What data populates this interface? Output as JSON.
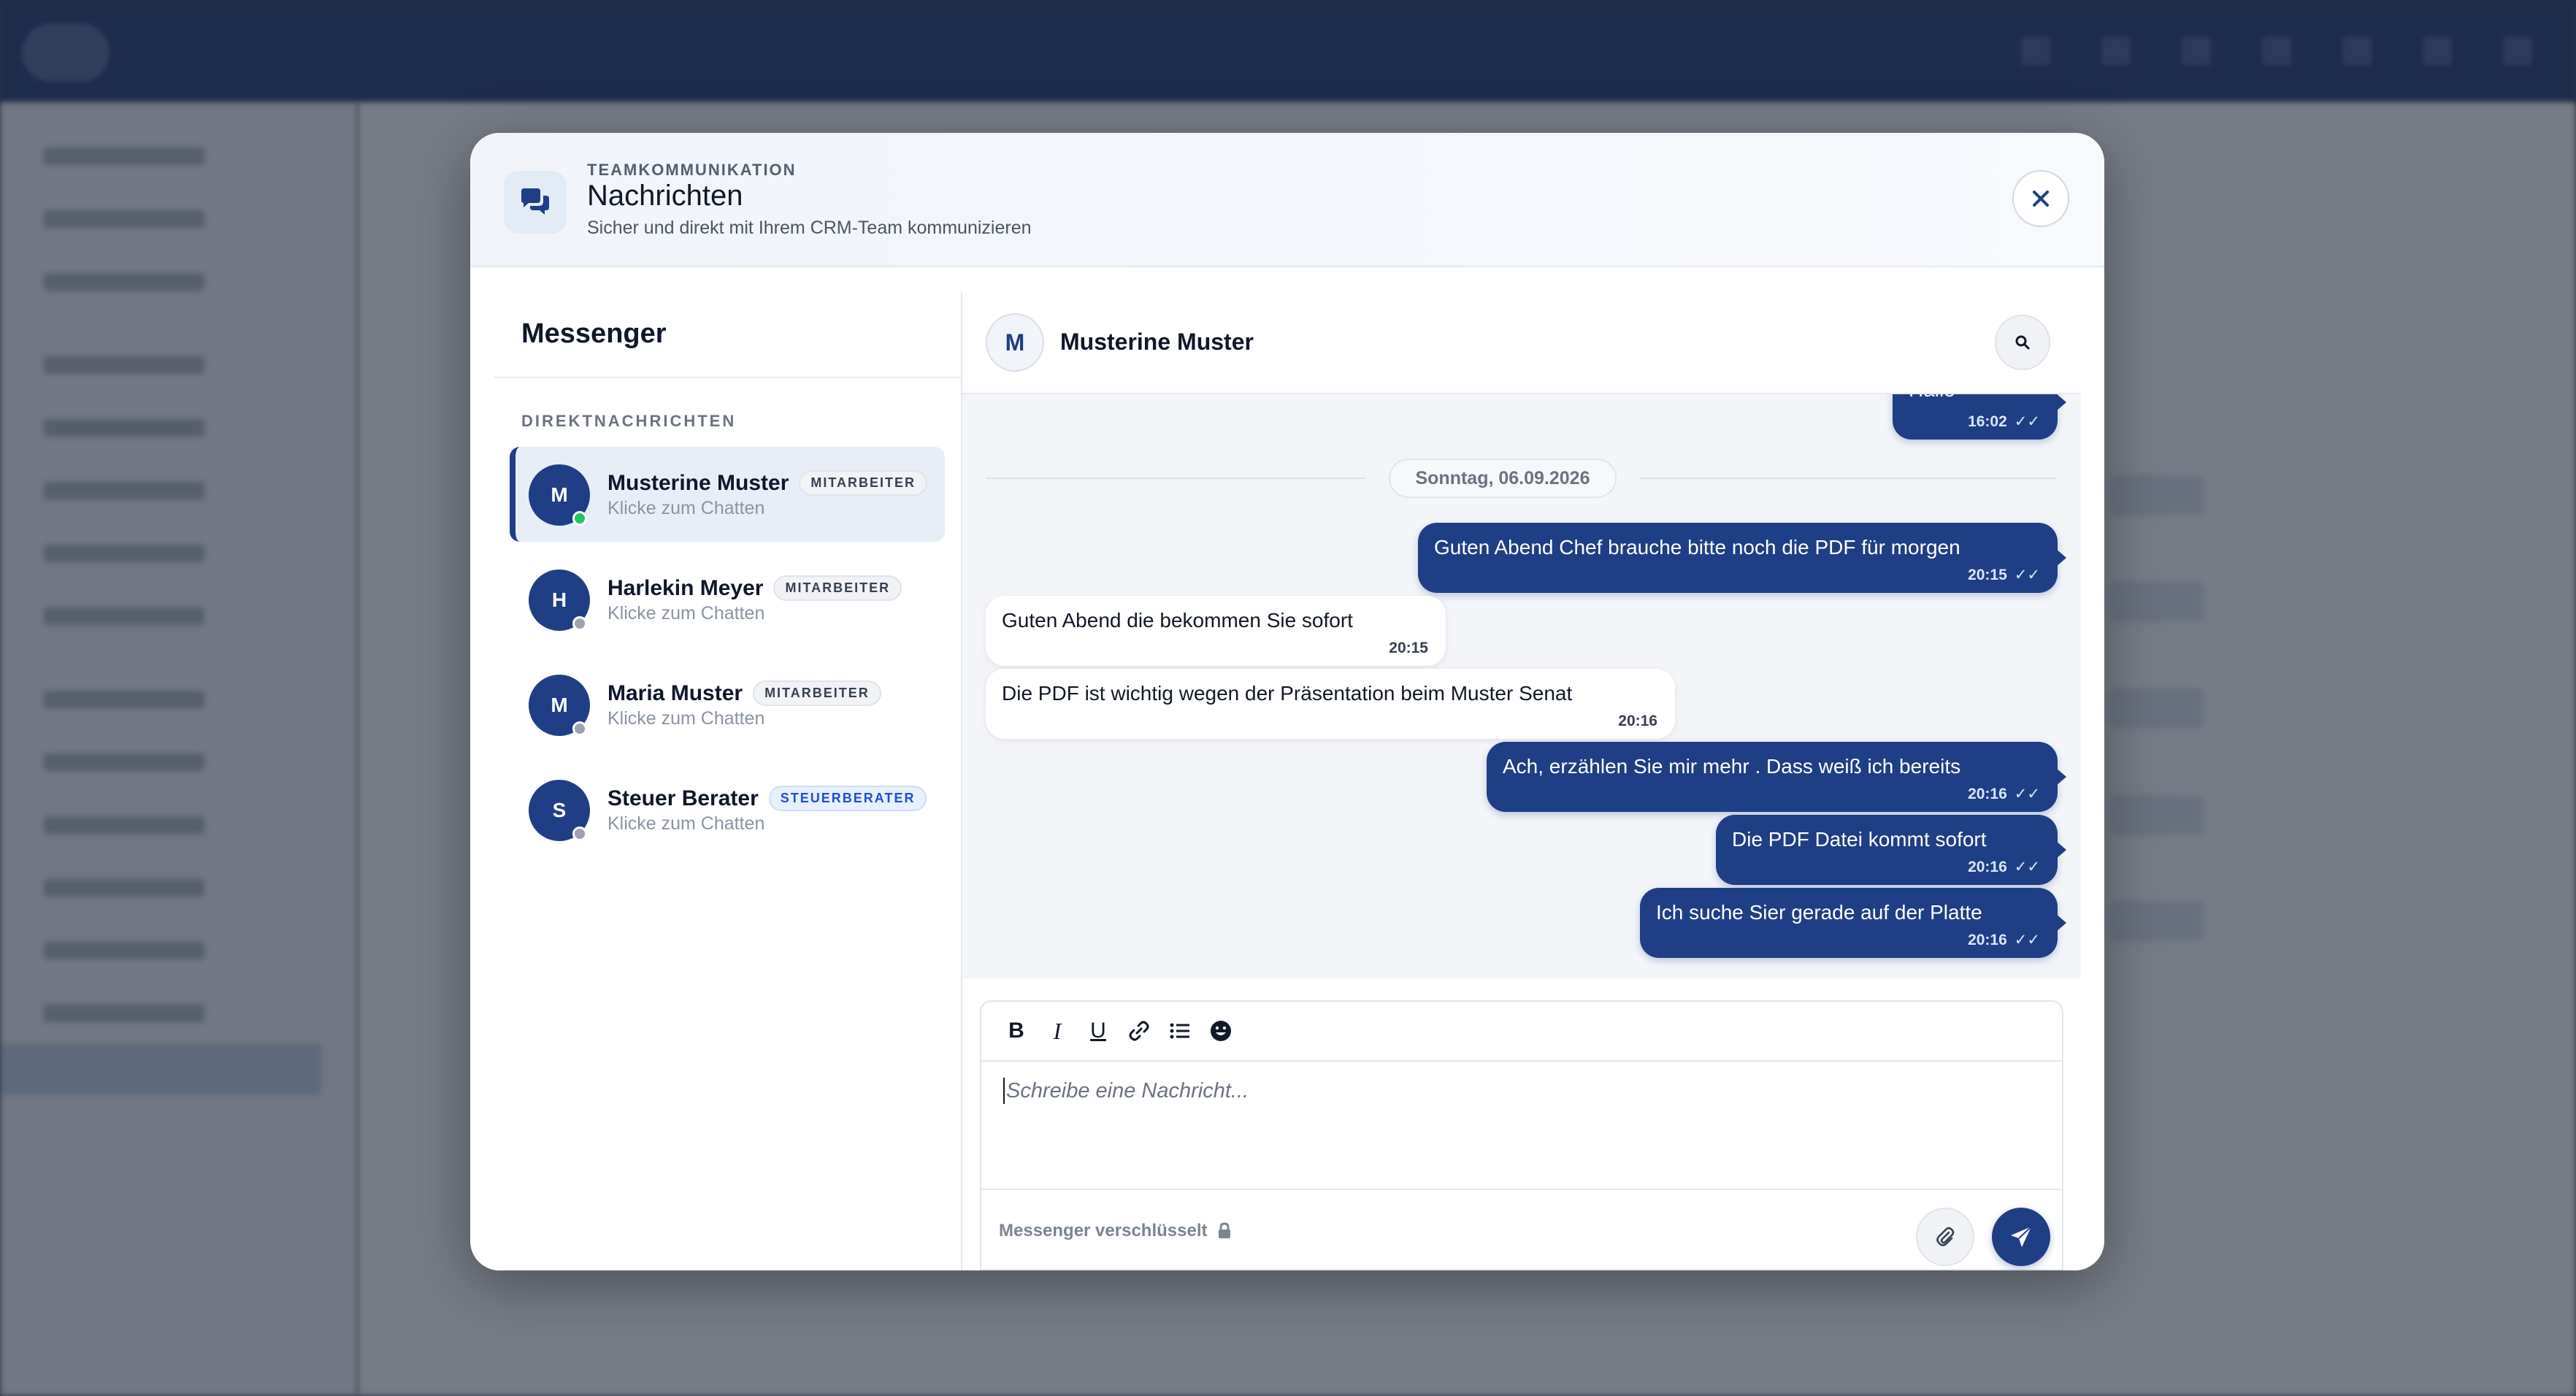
{
  "modal": {
    "kicker": "TEAMKOMMUNIKATION",
    "title": "Nachrichten",
    "subtitle": "Sicher und direkt mit Ihrem CRM-Team kommunizieren"
  },
  "sidebar": {
    "title": "Messenger",
    "section_label": "DIREKTNACHRICHTEN",
    "contacts": [
      {
        "initial": "M",
        "name": "Musterine Muster",
        "role": "MITARBEITER",
        "sub": "Klicke zum Chatten",
        "status": "online",
        "active": true
      },
      {
        "initial": "H",
        "name": "Harlekin Meyer",
        "role": "MITARBEITER",
        "sub": "Klicke zum Chatten",
        "status": "offline",
        "active": false
      },
      {
        "initial": "M",
        "name": "Maria Muster",
        "role": "MITARBEITER",
        "sub": "Klicke zum Chatten",
        "status": "offline",
        "active": false
      },
      {
        "initial": "S",
        "name": "Steuer Berater",
        "role": "STEUERBERATER",
        "sub": "Klicke zum Chatten",
        "status": "offline",
        "active": false
      }
    ]
  },
  "chat": {
    "initial": "M",
    "name": "Musterine Muster",
    "date_divider": "Sonntag, 06.09.2026",
    "messages": [
      {
        "dir": "out",
        "text": "Hallo",
        "time": "16:02"
      },
      {
        "dir": "out",
        "text": "Guten Abend Chef brauche bitte noch die PDF für morgen",
        "time": "20:15"
      },
      {
        "dir": "in",
        "text": "Guten Abend die bekommen Sie sofort",
        "time": "20:15"
      },
      {
        "dir": "in",
        "text": "Die PDF ist wichtig wegen der Präsentation beim Muster Senat",
        "time": "20:16"
      },
      {
        "dir": "out",
        "text": "Ach, erzählen Sie mir mehr . Dass weiß ich bereits",
        "time": "20:16"
      },
      {
        "dir": "out",
        "text": "Die PDF Datei kommt sofort",
        "time": "20:16"
      },
      {
        "dir": "out",
        "text": "Ich suche Sier gerade auf der Platte",
        "time": "20:16"
      }
    ]
  },
  "composer": {
    "placeholder": "Schreibe eine Nachricht...",
    "encryption_note": "Messenger verschlüsselt",
    "toolbar": [
      "bold-icon",
      "italic-icon",
      "underline-icon",
      "link-icon",
      "list-icon",
      "emoji-icon"
    ]
  },
  "colors": {
    "brand": "#1e3f85",
    "online": "#22c55e",
    "offline": "#9ca3af"
  }
}
